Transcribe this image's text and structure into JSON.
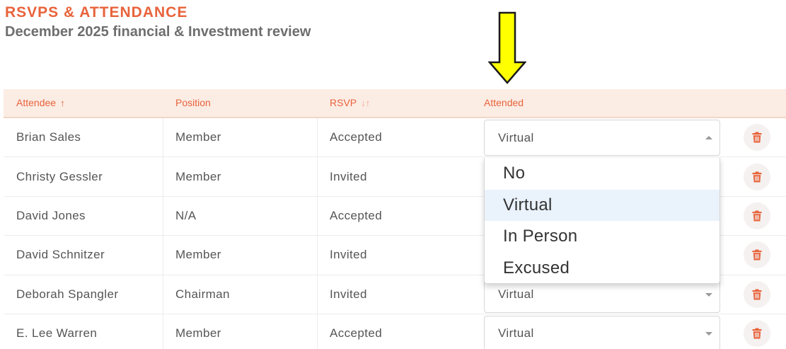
{
  "header": {
    "title": "RSVPS & ATTENDANCE",
    "subtitle": "December 2025 financial & Investment review"
  },
  "colors": {
    "accent": "#e8633b",
    "header_bg": "#fbece4",
    "annotation_arrow": "#ffff00",
    "option_highlight": "#eaf2fb"
  },
  "table": {
    "columns": [
      {
        "label": "Attendee",
        "sort_icon": "↑"
      },
      {
        "label": "Position",
        "sort_icon": ""
      },
      {
        "label": "RSVP",
        "sort_icon": "↓↑"
      },
      {
        "label": "Attended",
        "sort_icon": ""
      }
    ],
    "rows": [
      {
        "name": "Brian Sales",
        "position": "Member",
        "rsvp": "Accepted",
        "attended": "Virtual"
      },
      {
        "name": "Christy Gessler",
        "position": "Member",
        "rsvp": "Invited",
        "attended": ""
      },
      {
        "name": "David Jones",
        "position": "N/A",
        "rsvp": "Accepted",
        "attended": ""
      },
      {
        "name": "David Schnitzer",
        "position": "Member",
        "rsvp": "Invited",
        "attended": ""
      },
      {
        "name": "Deborah Spangler",
        "position": "Chairman",
        "rsvp": "Invited",
        "attended": "Virtual"
      },
      {
        "name": "E. Lee Warren",
        "position": "Member",
        "rsvp": "Accepted",
        "attended": "Virtual"
      }
    ]
  },
  "dropdown": {
    "options": [
      "No",
      "Virtual",
      "In Person",
      "Excused"
    ],
    "selected": "Virtual"
  }
}
